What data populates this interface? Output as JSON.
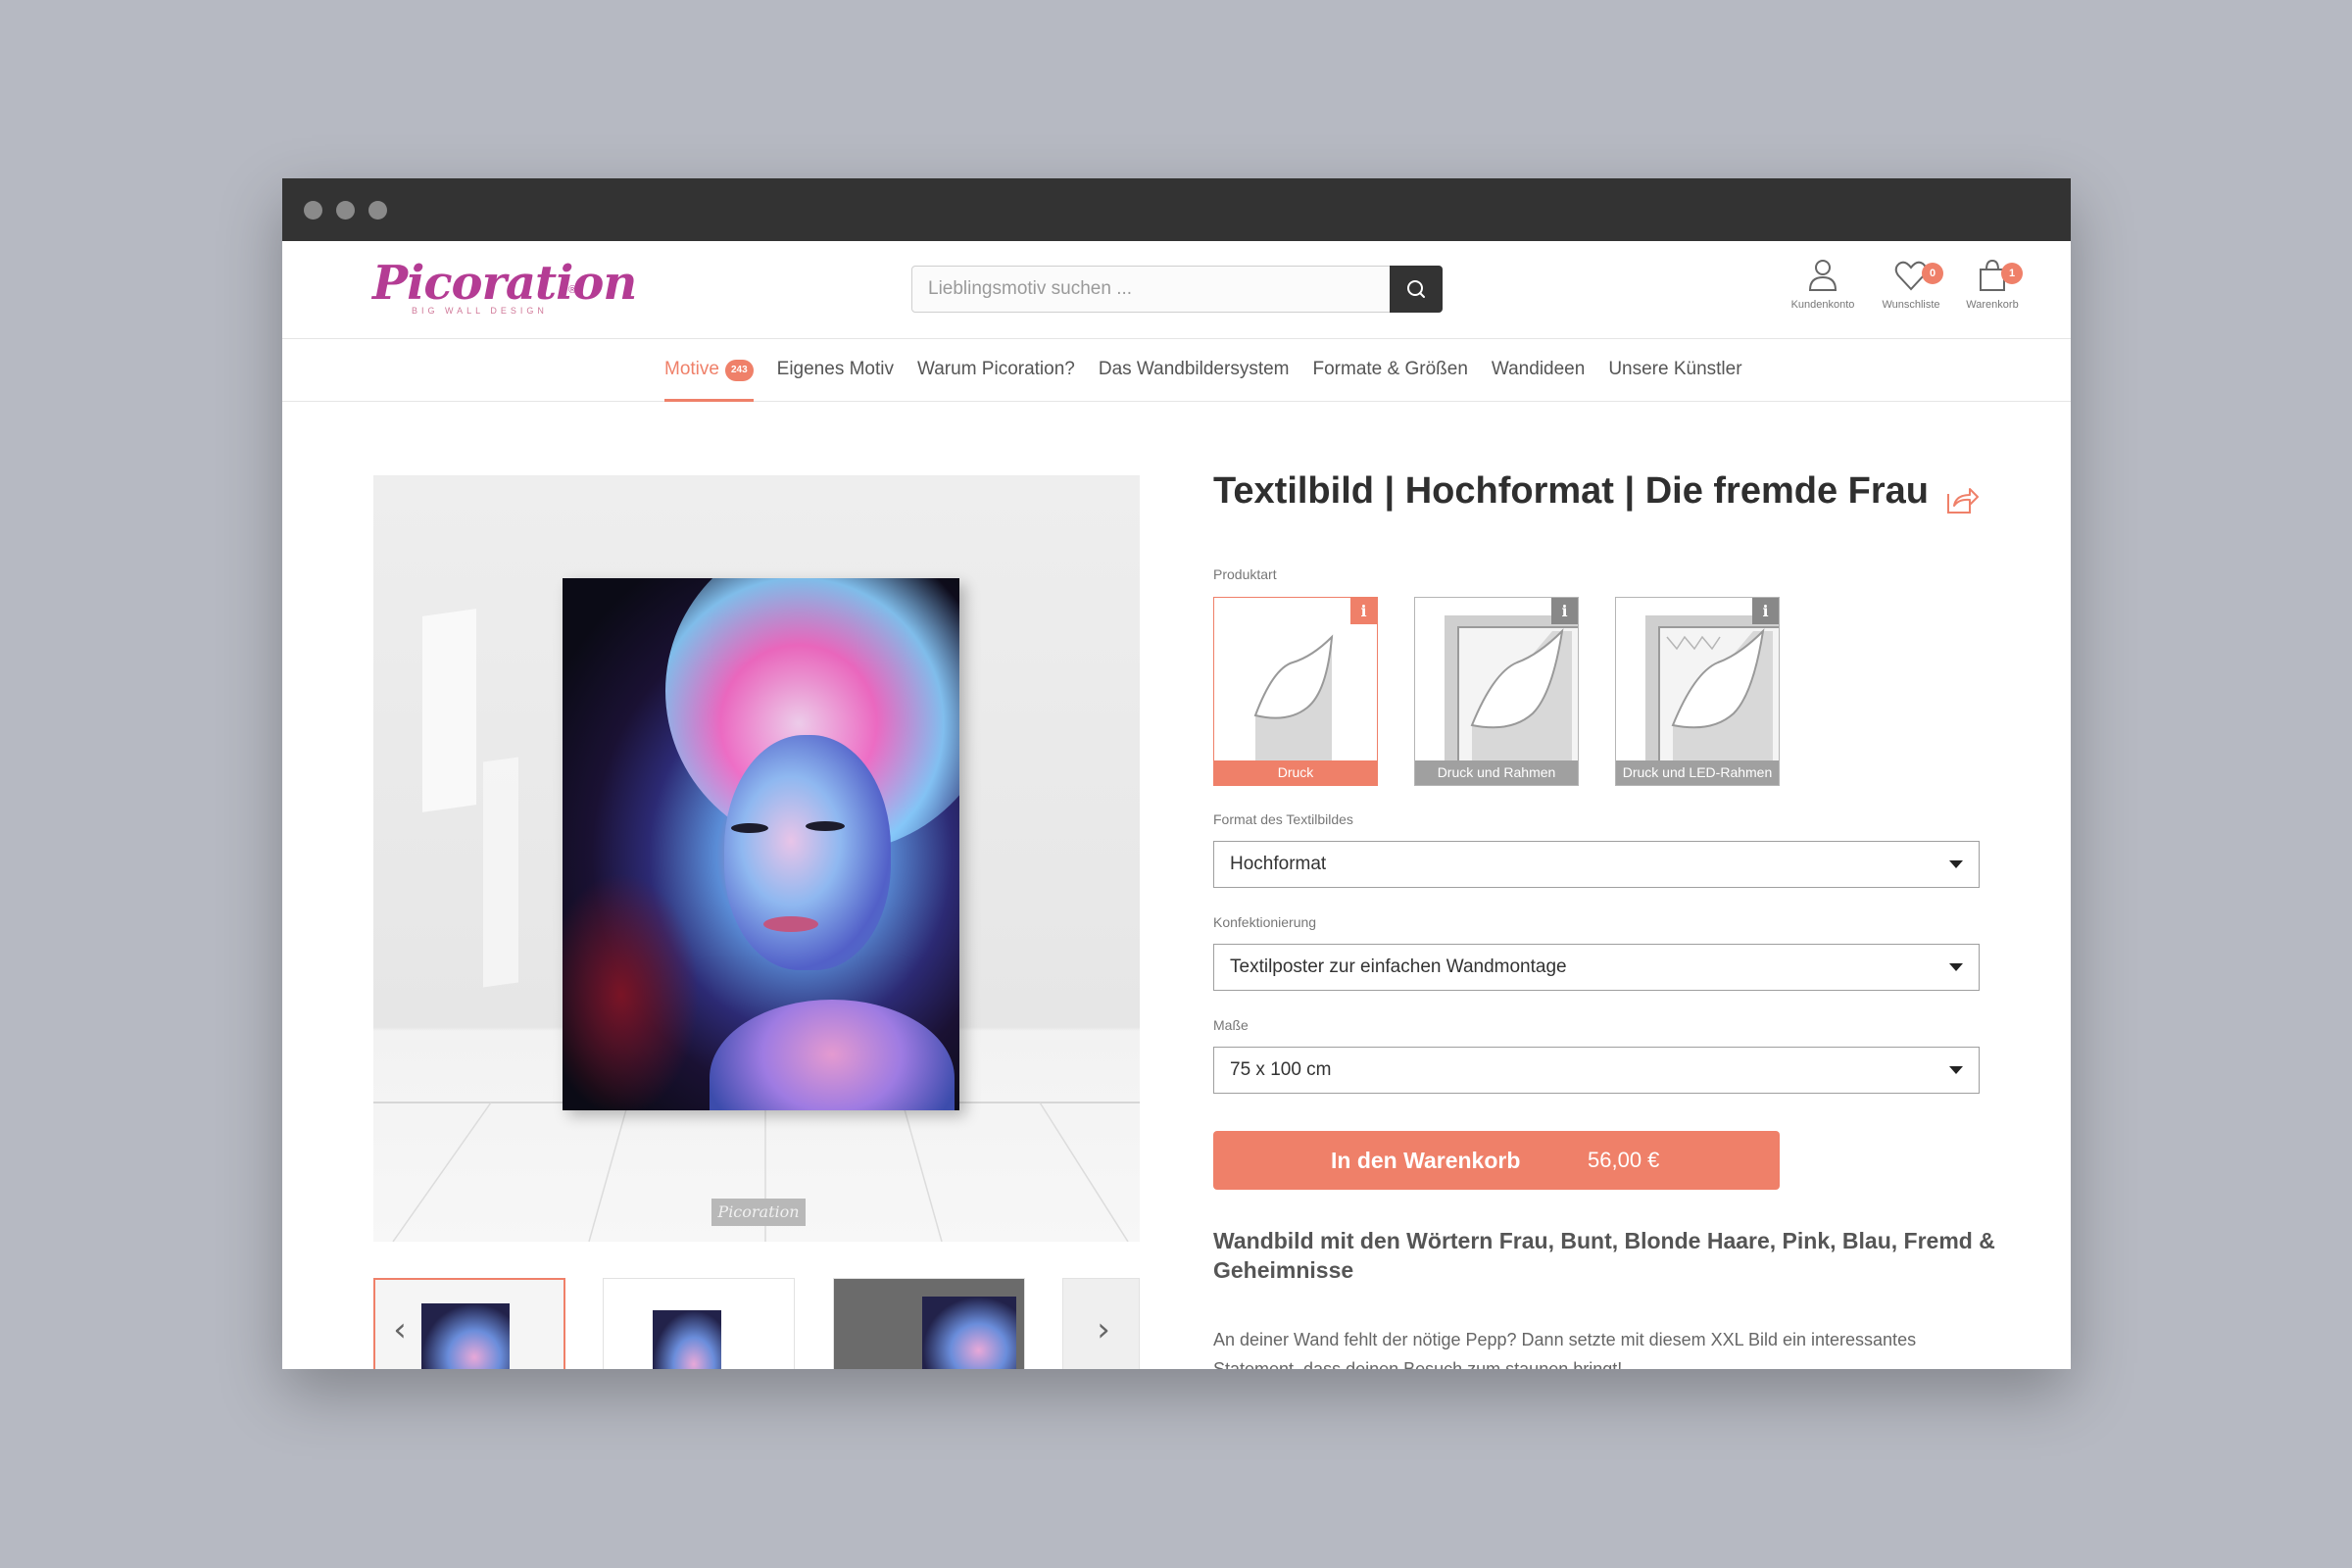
{
  "browser": {
    "window_dots": [
      "close",
      "minimize",
      "maximize"
    ]
  },
  "header": {
    "logo_text": "Picoration",
    "logo_registered": "®",
    "logo_tagline": "BIG WALL DESIGN",
    "search_placeholder": "Lieblingsmotiv suchen ...",
    "search_icon": "search-icon",
    "account": {
      "label": "Kundenkonto",
      "icon": "user-icon"
    },
    "wishlist": {
      "label": "Wunschliste",
      "icon": "heart-icon",
      "count": "0"
    },
    "cart": {
      "label": "Warenkorb",
      "icon": "bag-icon",
      "count": "1"
    }
  },
  "nav": {
    "items": [
      {
        "label": "Motive",
        "badge": "243",
        "active": true
      },
      {
        "label": "Eigenes Motiv"
      },
      {
        "label": "Warum Picoration?"
      },
      {
        "label": "Das Wandbildersystem"
      },
      {
        "label": "Formate & Größen"
      },
      {
        "label": "Wandideen"
      },
      {
        "label": "Unsere Künstler"
      }
    ]
  },
  "gallery": {
    "watermark": "Picoration",
    "thumbnail_count": 4,
    "active_thumbnail": 1,
    "prev_arrow": "‹",
    "next_arrow": "›"
  },
  "product": {
    "title": "Textilbild | Hochformat | Die fremde Frau",
    "share_icon": "share-icon",
    "type_label": "Produktart",
    "types": [
      {
        "label": "Druck",
        "info": "i",
        "selected": true
      },
      {
        "label": "Druck und Rahmen",
        "info": "i"
      },
      {
        "label": "Druck und LED-Rahmen",
        "info": "i"
      }
    ],
    "format_label": "Format des Textilbildes",
    "format_value": "Hochformat",
    "assembly_label": "Konfektionierung",
    "assembly_value": "Textilposter zur einfachen Wandmontage",
    "size_label": "Maße",
    "size_value": "75 x 100 cm",
    "cart_button": "In den Warenkorb",
    "price": "56,00 €",
    "description_heading": "Wandbild mit den Wörtern Frau, Bunt, Blonde Haare, Pink, Blau, Fremd & Geheimnisse",
    "description_text": "An deiner Wand fehlt der nötige Pepp? Dann setzte mit diesem XXL Bild ein interessantes Statement, dass deinen Besuch zum staunen bringt!"
  },
  "colors": {
    "accent": "#ef8069",
    "brand": "#b43c94",
    "titlebar": "#333333",
    "backdrop": "#b6b9c2"
  }
}
